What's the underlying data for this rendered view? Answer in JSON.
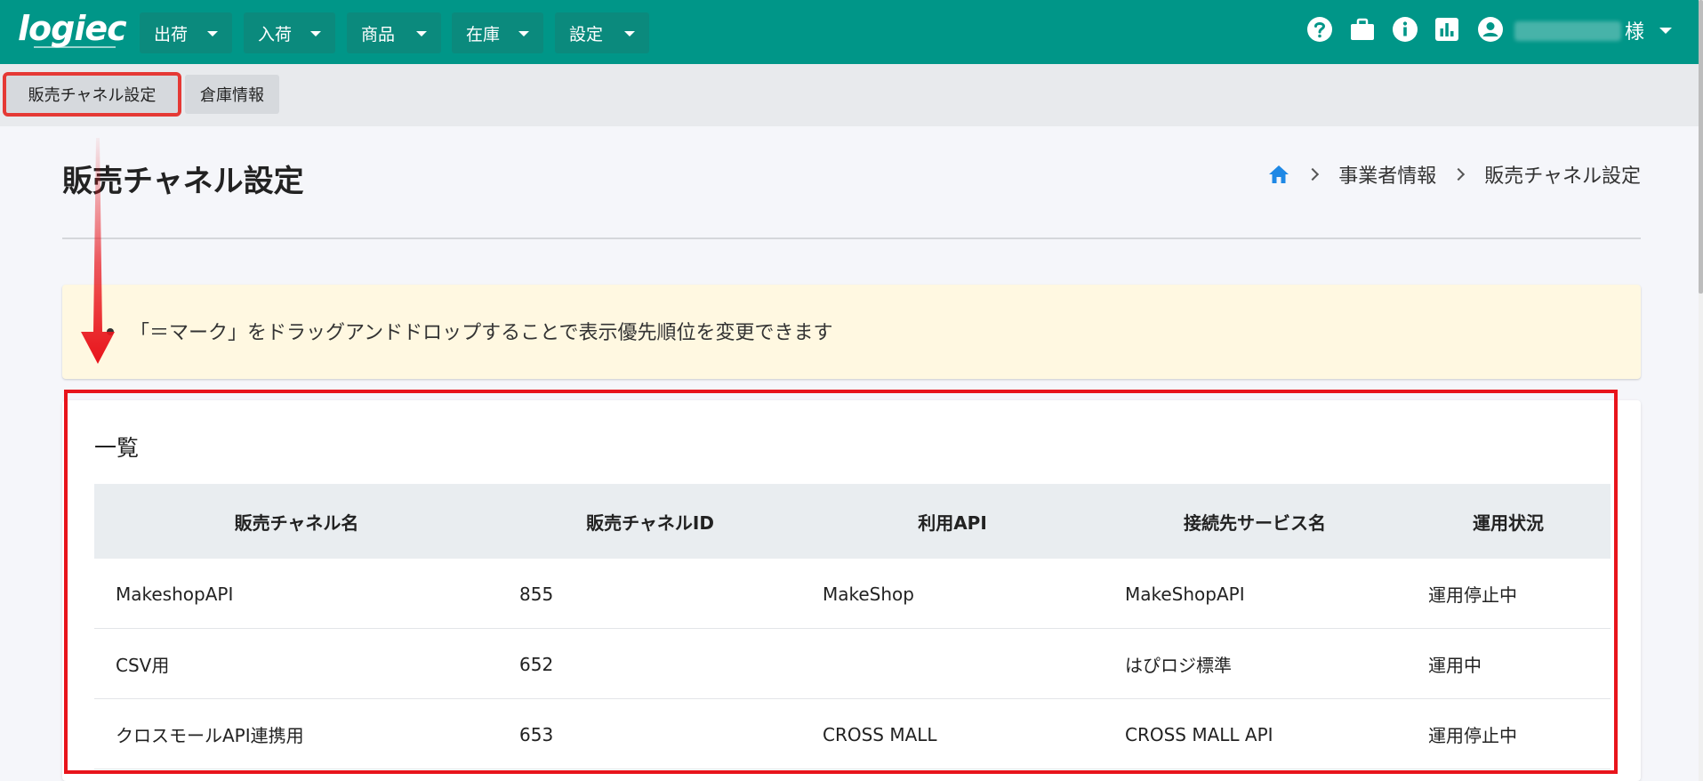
{
  "app": {
    "logo_text": "logiec",
    "menus": [
      {
        "label": "出荷"
      },
      {
        "label": "入荷"
      },
      {
        "label": "商品"
      },
      {
        "label": "在庫"
      },
      {
        "label": "設定"
      }
    ],
    "icons": [
      "help-icon",
      "briefcase-icon",
      "info-icon",
      "chart-icon",
      "user-icon"
    ],
    "user_suffix": "様"
  },
  "subtabs": [
    {
      "label": "販売チャネル設定",
      "active": true
    },
    {
      "label": "倉庫情報",
      "active": false
    }
  ],
  "page": {
    "title": "販売チャネル設定",
    "breadcrumb": [
      "事業者情報",
      "販売チャネル設定"
    ]
  },
  "notice": {
    "text": "「＝マーク」をドラッグアンドドロップすることで表示優先順位を変更できます"
  },
  "list": {
    "title": "一覧",
    "headers": [
      "販売チャネル名",
      "販売チャネルID",
      "利用API",
      "接続先サービス名",
      "運用状況"
    ],
    "rows": [
      [
        "MakeshopAPI",
        "855",
        "MakeShop",
        "MakeShopAPI",
        "運用停止中"
      ],
      [
        "CSV用",
        "652",
        "",
        "はぴロジ標準",
        "運用中"
      ],
      [
        "クロスモールAPI連携用",
        "653",
        "CROSS MALL",
        "CROSS MALL API",
        "運用停止中"
      ]
    ]
  },
  "colors": {
    "nav_bg": "#009688",
    "highlight": "#e8141b",
    "notice_bg": "#fff8e1",
    "breadcrumb_home": "#1e88e5"
  }
}
